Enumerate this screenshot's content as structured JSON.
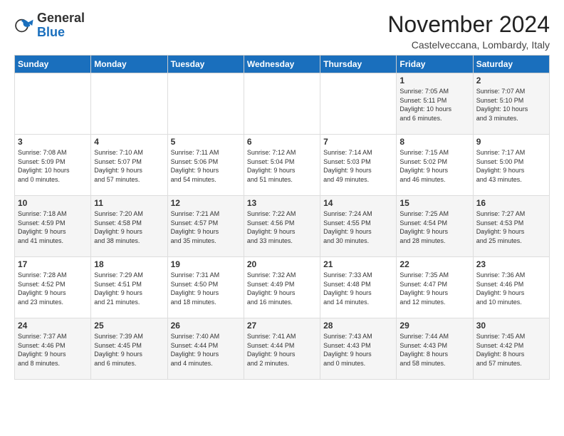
{
  "logo": {
    "general": "General",
    "blue": "Blue"
  },
  "title": "November 2024",
  "location": "Castelveccana, Lombardy, Italy",
  "weekdays": [
    "Sunday",
    "Monday",
    "Tuesday",
    "Wednesday",
    "Thursday",
    "Friday",
    "Saturday"
  ],
  "weeks": [
    [
      {
        "day": "",
        "info": ""
      },
      {
        "day": "",
        "info": ""
      },
      {
        "day": "",
        "info": ""
      },
      {
        "day": "",
        "info": ""
      },
      {
        "day": "",
        "info": ""
      },
      {
        "day": "1",
        "info": "Sunrise: 7:05 AM\nSunset: 5:11 PM\nDaylight: 10 hours\nand 6 minutes."
      },
      {
        "day": "2",
        "info": "Sunrise: 7:07 AM\nSunset: 5:10 PM\nDaylight: 10 hours\nand 3 minutes."
      }
    ],
    [
      {
        "day": "3",
        "info": "Sunrise: 7:08 AM\nSunset: 5:09 PM\nDaylight: 10 hours\nand 0 minutes."
      },
      {
        "day": "4",
        "info": "Sunrise: 7:10 AM\nSunset: 5:07 PM\nDaylight: 9 hours\nand 57 minutes."
      },
      {
        "day": "5",
        "info": "Sunrise: 7:11 AM\nSunset: 5:06 PM\nDaylight: 9 hours\nand 54 minutes."
      },
      {
        "day": "6",
        "info": "Sunrise: 7:12 AM\nSunset: 5:04 PM\nDaylight: 9 hours\nand 51 minutes."
      },
      {
        "day": "7",
        "info": "Sunrise: 7:14 AM\nSunset: 5:03 PM\nDaylight: 9 hours\nand 49 minutes."
      },
      {
        "day": "8",
        "info": "Sunrise: 7:15 AM\nSunset: 5:02 PM\nDaylight: 9 hours\nand 46 minutes."
      },
      {
        "day": "9",
        "info": "Sunrise: 7:17 AM\nSunset: 5:00 PM\nDaylight: 9 hours\nand 43 minutes."
      }
    ],
    [
      {
        "day": "10",
        "info": "Sunrise: 7:18 AM\nSunset: 4:59 PM\nDaylight: 9 hours\nand 41 minutes."
      },
      {
        "day": "11",
        "info": "Sunrise: 7:20 AM\nSunset: 4:58 PM\nDaylight: 9 hours\nand 38 minutes."
      },
      {
        "day": "12",
        "info": "Sunrise: 7:21 AM\nSunset: 4:57 PM\nDaylight: 9 hours\nand 35 minutes."
      },
      {
        "day": "13",
        "info": "Sunrise: 7:22 AM\nSunset: 4:56 PM\nDaylight: 9 hours\nand 33 minutes."
      },
      {
        "day": "14",
        "info": "Sunrise: 7:24 AM\nSunset: 4:55 PM\nDaylight: 9 hours\nand 30 minutes."
      },
      {
        "day": "15",
        "info": "Sunrise: 7:25 AM\nSunset: 4:54 PM\nDaylight: 9 hours\nand 28 minutes."
      },
      {
        "day": "16",
        "info": "Sunrise: 7:27 AM\nSunset: 4:53 PM\nDaylight: 9 hours\nand 25 minutes."
      }
    ],
    [
      {
        "day": "17",
        "info": "Sunrise: 7:28 AM\nSunset: 4:52 PM\nDaylight: 9 hours\nand 23 minutes."
      },
      {
        "day": "18",
        "info": "Sunrise: 7:29 AM\nSunset: 4:51 PM\nDaylight: 9 hours\nand 21 minutes."
      },
      {
        "day": "19",
        "info": "Sunrise: 7:31 AM\nSunset: 4:50 PM\nDaylight: 9 hours\nand 18 minutes."
      },
      {
        "day": "20",
        "info": "Sunrise: 7:32 AM\nSunset: 4:49 PM\nDaylight: 9 hours\nand 16 minutes."
      },
      {
        "day": "21",
        "info": "Sunrise: 7:33 AM\nSunset: 4:48 PM\nDaylight: 9 hours\nand 14 minutes."
      },
      {
        "day": "22",
        "info": "Sunrise: 7:35 AM\nSunset: 4:47 PM\nDaylight: 9 hours\nand 12 minutes."
      },
      {
        "day": "23",
        "info": "Sunrise: 7:36 AM\nSunset: 4:46 PM\nDaylight: 9 hours\nand 10 minutes."
      }
    ],
    [
      {
        "day": "24",
        "info": "Sunrise: 7:37 AM\nSunset: 4:46 PM\nDaylight: 9 hours\nand 8 minutes."
      },
      {
        "day": "25",
        "info": "Sunrise: 7:39 AM\nSunset: 4:45 PM\nDaylight: 9 hours\nand 6 minutes."
      },
      {
        "day": "26",
        "info": "Sunrise: 7:40 AM\nSunset: 4:44 PM\nDaylight: 9 hours\nand 4 minutes."
      },
      {
        "day": "27",
        "info": "Sunrise: 7:41 AM\nSunset: 4:44 PM\nDaylight: 9 hours\nand 2 minutes."
      },
      {
        "day": "28",
        "info": "Sunrise: 7:43 AM\nSunset: 4:43 PM\nDaylight: 9 hours\nand 0 minutes."
      },
      {
        "day": "29",
        "info": "Sunrise: 7:44 AM\nSunset: 4:43 PM\nDaylight: 8 hours\nand 58 minutes."
      },
      {
        "day": "30",
        "info": "Sunrise: 7:45 AM\nSunset: 4:42 PM\nDaylight: 8 hours\nand 57 minutes."
      }
    ]
  ]
}
